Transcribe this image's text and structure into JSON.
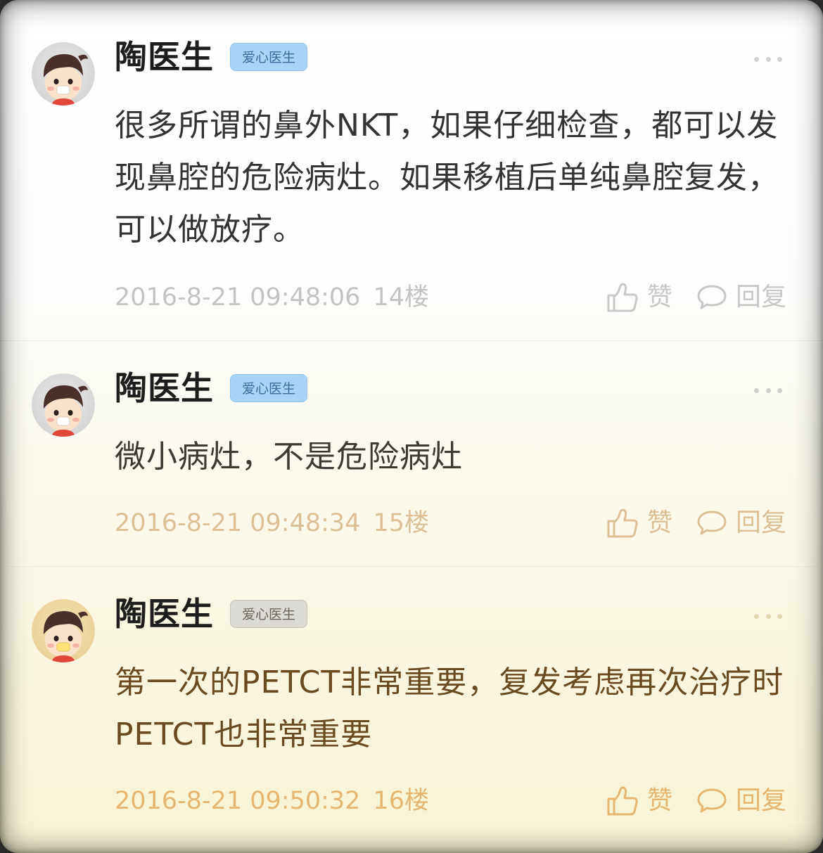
{
  "posts": [
    {
      "author": "陶医生",
      "badge": "爱心医生",
      "content": "很多所谓的鼻外NKT，如果仔细检查，都可以发现鼻腔的危险病灶。如果移植后单纯鼻腔复发，可以做放疗。",
      "time": "2016-8-21 09:48:06",
      "floor": "14楼",
      "like_label": "赞",
      "reply_label": "回复"
    },
    {
      "author": "陶医生",
      "badge": "爱心医生",
      "content": "微小病灶，不是危险病灶",
      "time": "2016-8-21 09:48:34",
      "floor": "15楼",
      "like_label": "赞",
      "reply_label": "回复"
    },
    {
      "author": "陶医生",
      "badge": "爱心医生",
      "content": "第一次的PETCT非常重要，复发考虑再次治疗时PETCT也非常重要",
      "time": "2016-8-21 09:50:32",
      "floor": "16楼",
      "like_label": "赞",
      "reply_label": "回复"
    }
  ],
  "icons": {
    "avatar": "cartoon-doctor-avatar",
    "more": "more-dots-icon",
    "like": "thumbs-up-icon",
    "reply": "speech-bubble-icon"
  }
}
